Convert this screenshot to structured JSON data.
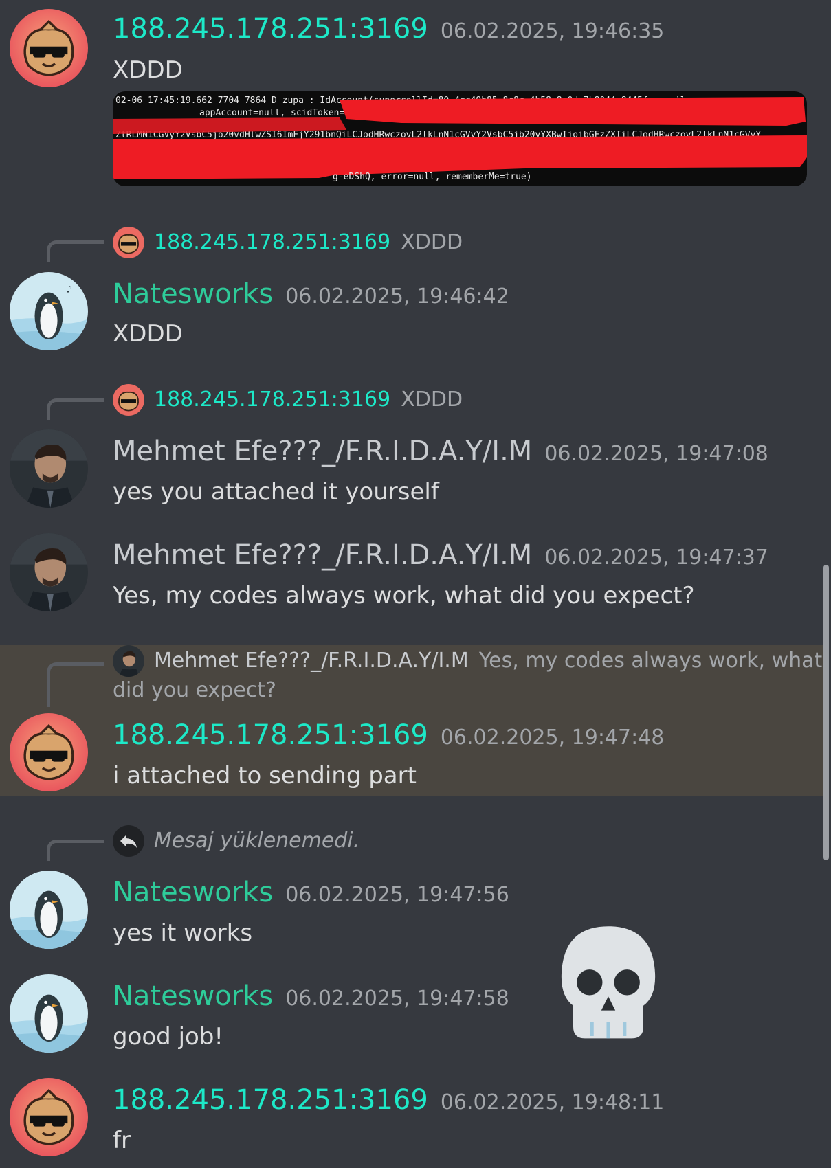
{
  "messages": [
    {
      "author": "188.245.178.251:3169",
      "time": "06.02.2025, 19:46:35",
      "text": "XDDD"
    },
    {
      "reply_to": {
        "author": "188.245.178.251:3169",
        "text": "XDDD"
      },
      "author": "Natesworks",
      "time": "06.02.2025, 19:46:42",
      "text": "XDDD"
    },
    {
      "reply_to": {
        "author": "188.245.178.251:3169",
        "text": "XDDD"
      },
      "author": "Mehmet Efe???_/F.R.I.D.A.Y/I.M",
      "time": "06.02.2025, 19:47:08",
      "text": "yes you attached it yourself"
    },
    {
      "author": "Mehmet Efe???_/F.R.I.D.A.Y/I.M",
      "time": "06.02.2025, 19:47:37",
      "text": "Yes, my codes always work, what did you expect?"
    },
    {
      "reply_to": {
        "author": "Mehmet Efe???_/F.R.I.D.A.Y/I.M",
        "text_line1": "Yes, my codes always work, what",
        "text_line2": "did you expect?"
      },
      "author": "188.245.178.251:3169",
      "time": "06.02.2025, 19:47:48",
      "text": "i attached to sending part"
    },
    {
      "reply_to": {
        "text": "Mesaj yüklenemedi."
      },
      "author": "Natesworks",
      "time": "06.02.2025, 19:47:56",
      "text": "yes it works"
    },
    {
      "author": "Natesworks",
      "time": "06.02.2025, 19:47:58",
      "text": "good job!"
    },
    {
      "author": "188.245.178.251:3169",
      "time": "06.02.2025, 19:48:11",
      "text": "fr"
    }
  ],
  "attachment": {
    "line1": "02-06 17:45:19.662  7704  7864 D zupa    : IdAccount(supercellId=80-4cc49b85-8c8c-4b58-8c0d-7b8044c8445f, email=",
    "line2": "appAccount=null, scidToken=",
    "line3": "ZtRLMN1CGVyY2VsbC5jb20vdHlwZSI6ImFjY291bnQiLCJodHRwczovL2lkLnN1cGVyY2VsbC5jb20vYXBwIjoibGFzZXIiLCJodHRwczovL2lkLnN1cGVyY",
    "line4": "g-eDShQ, error=null, rememberMe=true)"
  },
  "reaction": {
    "emoji": "💀"
  },
  "colors": {
    "background": "#36393f",
    "highlight": "#4a4640",
    "ip_name": "#1de9c8",
    "nates_name": "#2ecc9a"
  }
}
